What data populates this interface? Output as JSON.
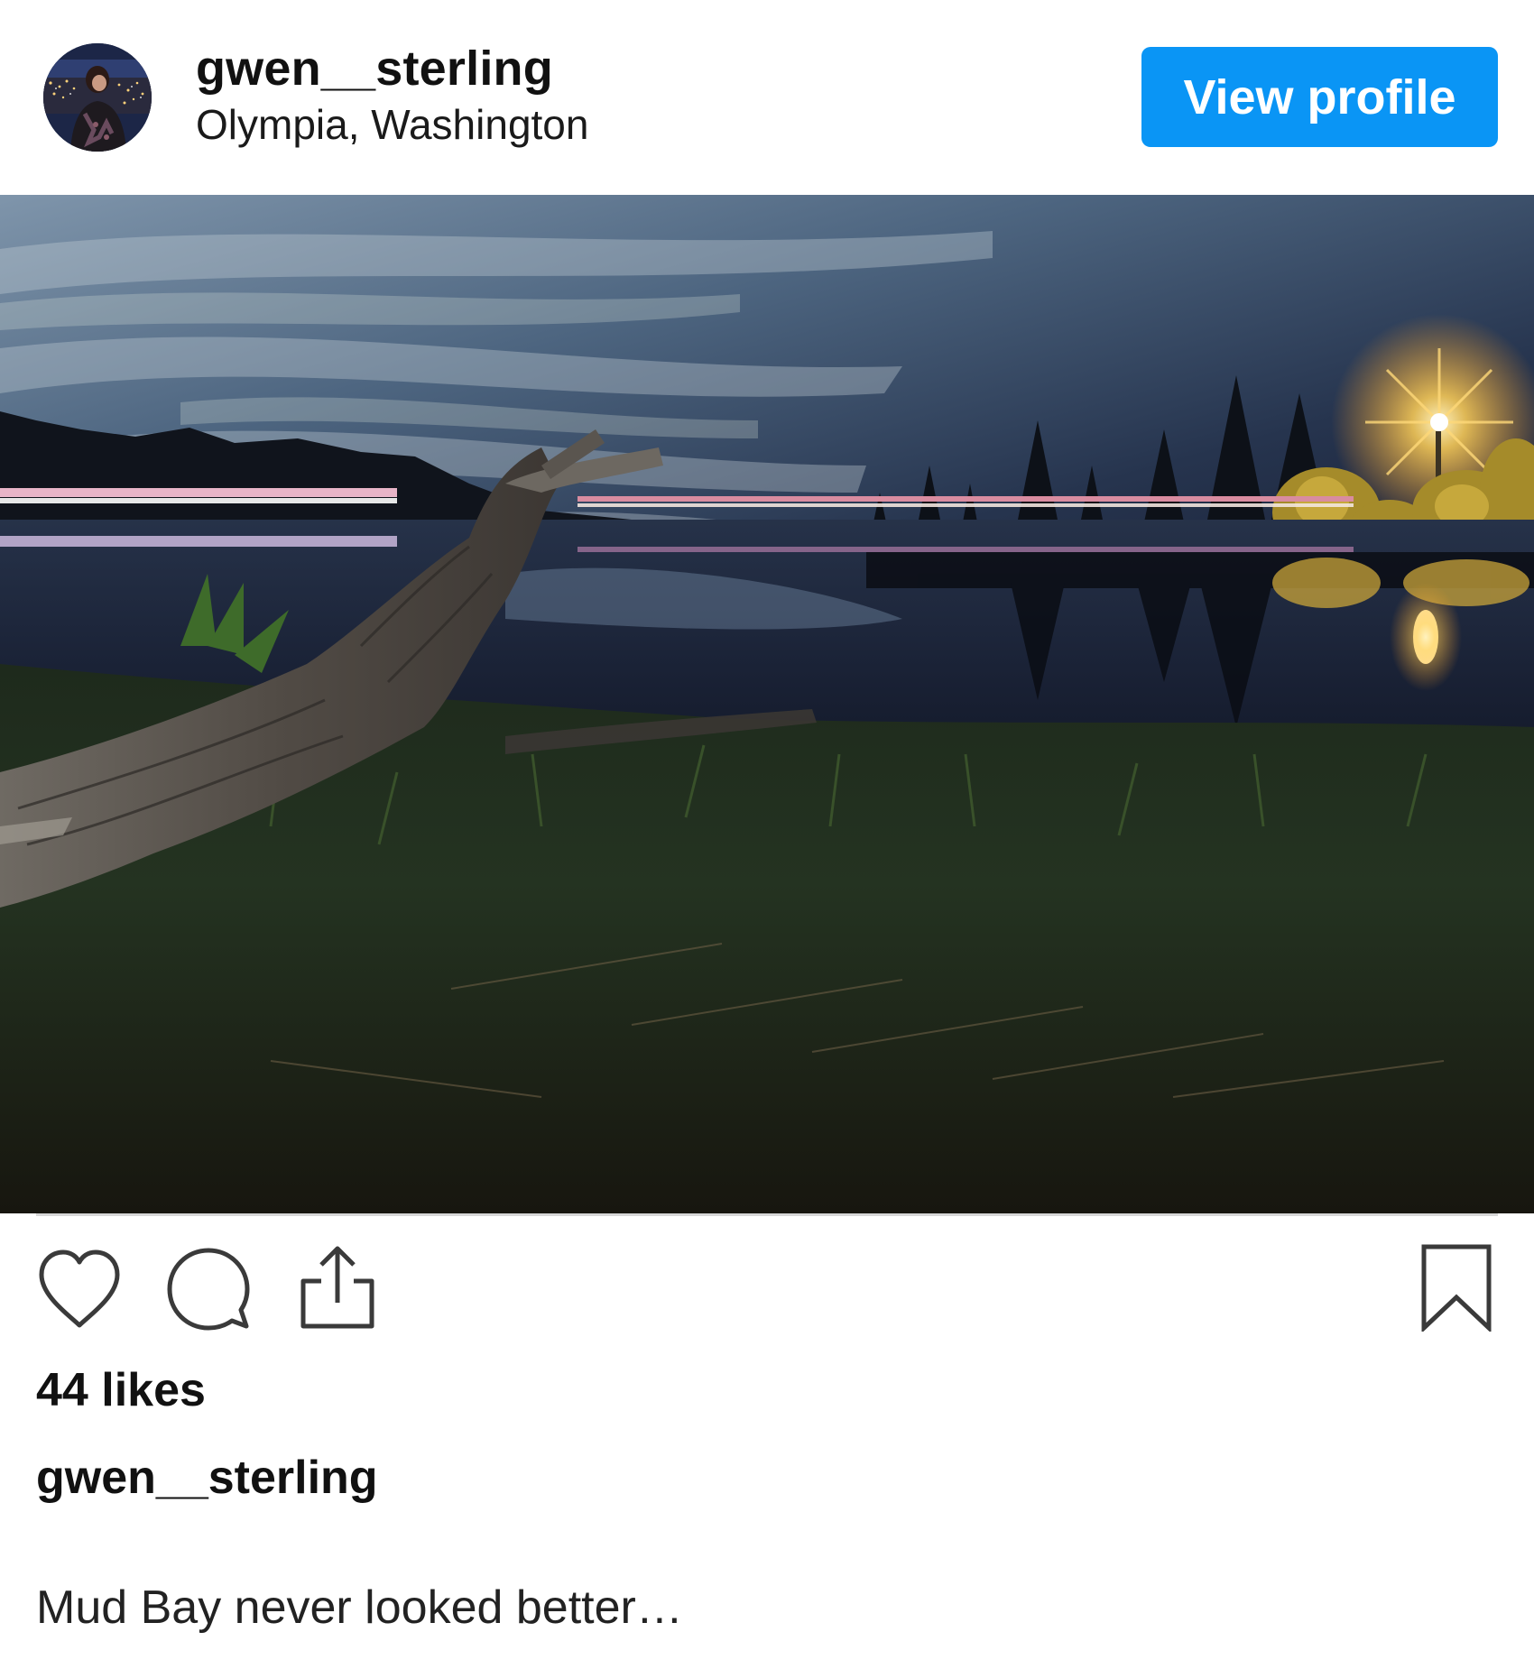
{
  "post": {
    "username": "gwen__sterling",
    "location": "Olympia, Washington",
    "view_profile_label": "View profile",
    "likes": "44 likes",
    "caption_user": "gwen__sterling",
    "caption_text": "Mud Bay never looked better…"
  },
  "icons": {
    "avatar": "avatar-photo",
    "like": "heart-outline-icon",
    "comment": "speech-bubble-icon",
    "share": "share-arrow-icon",
    "bookmark": "bookmark-outline-icon"
  },
  "colors": {
    "accent": "#0a95f5",
    "text": "#111111",
    "divider": "#d7d7d7"
  }
}
